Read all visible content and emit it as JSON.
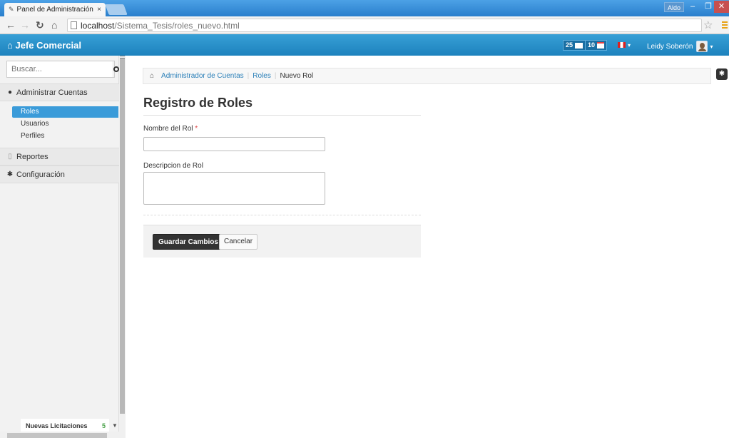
{
  "browser": {
    "tab_title": "Panel de Administración",
    "tab_close": "×",
    "user_badge": "Aldo",
    "url_host": "localhost",
    "url_path": "/Sistema_Tesis/roles_nuevo.html"
  },
  "header": {
    "brand": "Jefe Comercial",
    "messages_count": "25",
    "events_count": "10",
    "user_name": "Leidy Soberón"
  },
  "sidebar": {
    "search_placeholder": "Buscar...",
    "sections": [
      {
        "label": "Administrar Cuentas",
        "icon": "user-icon"
      },
      {
        "label": "Reportes",
        "icon": "report-icon"
      },
      {
        "label": "Configuración",
        "icon": "gear-icon"
      }
    ],
    "items": [
      {
        "label": "Roles",
        "active": true
      },
      {
        "label": "Usuarios"
      },
      {
        "label": "Perfiles"
      }
    ],
    "footer": {
      "label": "Nuevas Licitaciones",
      "count": "5"
    }
  },
  "breadcrumb": {
    "items": [
      "Administrador de Cuentas",
      "Roles"
    ],
    "current": "Nuevo Rol"
  },
  "form": {
    "title": "Registro de Roles",
    "name_label": "Nombre del Rol",
    "required_mark": "*",
    "name_value": "",
    "desc_label": "Descripcion de Rol",
    "desc_value": "",
    "save_label": "Guardar Cambios",
    "cancel_label": "Cancelar"
  },
  "colors": {
    "header": "#2a8fcb",
    "active_item": "#3a9bd9",
    "primary_button": "#333333"
  }
}
